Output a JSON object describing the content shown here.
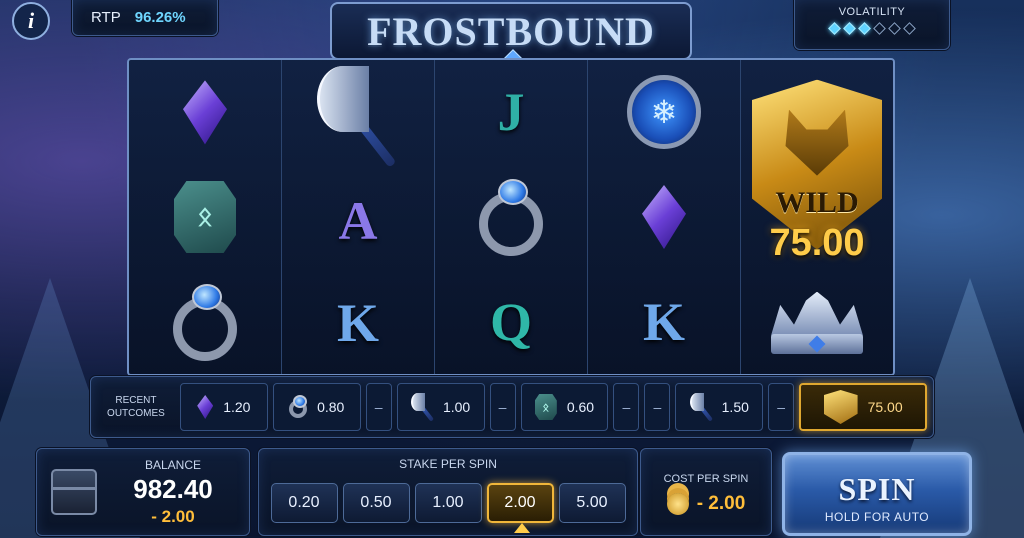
{
  "header": {
    "info_icon": "info-icon",
    "rtp_label": "RTP",
    "rtp_value": "96.26%",
    "title": "FROSTBOUND",
    "volatility_label": "VOLATILITY",
    "volatility_level": 3,
    "volatility_max": 6
  },
  "reels": [
    [
      "crystal-icon",
      "rune-stone-icon",
      "ring-icon"
    ],
    [
      "axe-icon",
      "A",
      "K"
    ],
    [
      "J",
      "ring-icon",
      "Q"
    ],
    [
      "amulet-icon",
      "crystal-icon",
      "K"
    ],
    [
      "wild-wolf-icon",
      "",
      "crown-icon"
    ]
  ],
  "wild": {
    "label": "WILD",
    "win_amount": "75.00"
  },
  "history": {
    "label_line1": "RECENT",
    "label_line2": "OUTCOMES",
    "items": [
      {
        "icon": "crystal-icon",
        "value": "1.20"
      },
      {
        "icon": "ring-icon",
        "value": "0.80"
      },
      {
        "icon": "",
        "value": "–"
      },
      {
        "icon": "axe-icon",
        "value": "1.00"
      },
      {
        "icon": "",
        "value": "–"
      },
      {
        "icon": "rune-stone-icon",
        "value": "0.60"
      },
      {
        "icon": "",
        "value": "–"
      },
      {
        "icon": "",
        "value": "–"
      },
      {
        "icon": "axe-icon",
        "value": "1.50"
      },
      {
        "icon": "",
        "value": "–"
      },
      {
        "icon": "wolf-icon",
        "value": "75.00"
      }
    ]
  },
  "balance": {
    "label": "BALANCE",
    "value": "982.40",
    "delta": "- 2.00"
  },
  "stake": {
    "label": "STAKE PER SPIN",
    "options": [
      "0.20",
      "0.50",
      "1.00",
      "2.00",
      "5.00"
    ],
    "selected": "2.00"
  },
  "cost": {
    "label": "COST PER SPIN",
    "value": "- 2.00"
  },
  "spin": {
    "label": "SPIN",
    "sublabel": "HOLD FOR AUTO"
  },
  "colors": {
    "accent_gold": "#ffbe3a",
    "accent_cyan": "#6fd6ff",
    "panel_border": "#3d5a8c"
  }
}
